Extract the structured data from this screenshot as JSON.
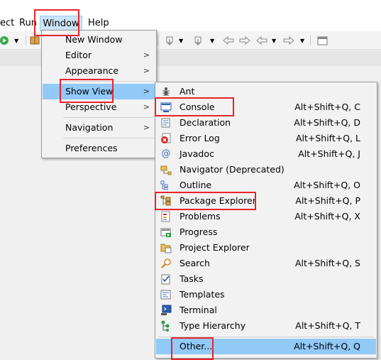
{
  "menubar": {
    "items": [
      "ect",
      "Run",
      "Window",
      "Help"
    ]
  },
  "window_menu": {
    "items": [
      {
        "label": "New Window",
        "submenu": false
      },
      {
        "label": "Editor",
        "submenu": true
      },
      {
        "label": "Appearance",
        "submenu": true
      },
      {
        "label": "Show View",
        "submenu": true,
        "highlighted": true
      },
      {
        "label": "Perspective",
        "submenu": true
      },
      {
        "label": "Navigation",
        "submenu": true
      },
      {
        "label": "Preferences",
        "submenu": false
      }
    ]
  },
  "show_view_menu": {
    "items": [
      {
        "label": "Ant",
        "shortcut": "",
        "icon": "ant-icon"
      },
      {
        "label": "Console",
        "shortcut": "Alt+Shift+Q, C",
        "icon": "console-icon"
      },
      {
        "label": "Declaration",
        "shortcut": "Alt+Shift+Q, D",
        "icon": "declaration-icon"
      },
      {
        "label": "Error Log",
        "shortcut": "Alt+Shift+Q, L",
        "icon": "error-log-icon"
      },
      {
        "label": "Javadoc",
        "shortcut": "Alt+Shift+Q, J",
        "icon": "javadoc-icon"
      },
      {
        "label": "Navigator (Deprecated)",
        "shortcut": "",
        "icon": "navigator-icon"
      },
      {
        "label": "Outline",
        "shortcut": "Alt+Shift+Q, O",
        "icon": "outline-icon"
      },
      {
        "label": "Package Explorer",
        "shortcut": "Alt+Shift+Q, P",
        "icon": "package-explorer-icon"
      },
      {
        "label": "Problems",
        "shortcut": "Alt+Shift+Q, X",
        "icon": "problems-icon"
      },
      {
        "label": "Progress",
        "shortcut": "",
        "icon": "progress-icon"
      },
      {
        "label": "Project Explorer",
        "shortcut": "",
        "icon": "project-explorer-icon"
      },
      {
        "label": "Search",
        "shortcut": "Alt+Shift+Q, S",
        "icon": "search-icon"
      },
      {
        "label": "Tasks",
        "shortcut": "",
        "icon": "tasks-icon"
      },
      {
        "label": "Templates",
        "shortcut": "",
        "icon": "templates-icon"
      },
      {
        "label": "Terminal",
        "shortcut": "",
        "icon": "terminal-icon"
      },
      {
        "label": "Type Hierarchy",
        "shortcut": "Alt+Shift+Q, T",
        "icon": "type-hierarchy-icon"
      },
      {
        "label": "Other...",
        "shortcut": "Alt+Shift+Q, Q",
        "icon": "",
        "highlighted": true
      }
    ]
  },
  "colors": {
    "highlight": "#91c9f7",
    "annotation_red": "#e8232b",
    "menu_bg": "#f2f2f2"
  }
}
